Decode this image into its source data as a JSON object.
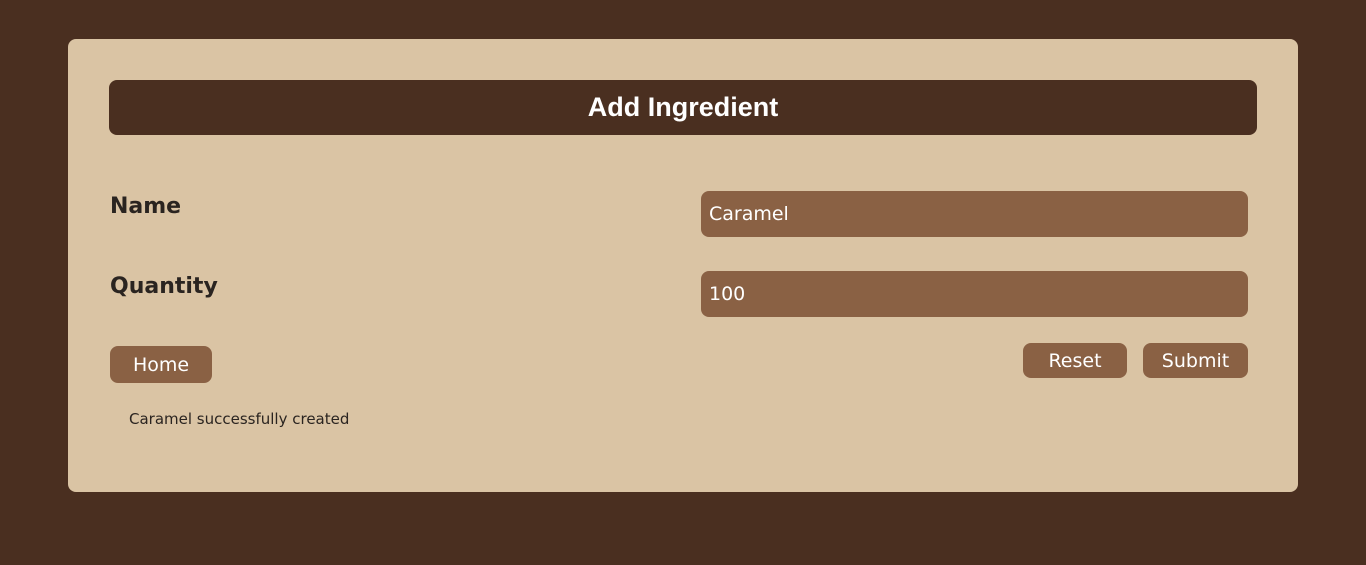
{
  "header": {
    "title": "Add Ingredient"
  },
  "form": {
    "name_label": "Name",
    "name_value": "Caramel",
    "quantity_label": "Quantity",
    "quantity_value": "100"
  },
  "buttons": {
    "home": "Home",
    "reset": "Reset",
    "submit": "Submit"
  },
  "status": {
    "message": "Caramel successfully created"
  },
  "colors": {
    "background": "#4a2f20",
    "card": "#dac4a4",
    "accent": "#8a6144",
    "text": "#2a2420"
  }
}
